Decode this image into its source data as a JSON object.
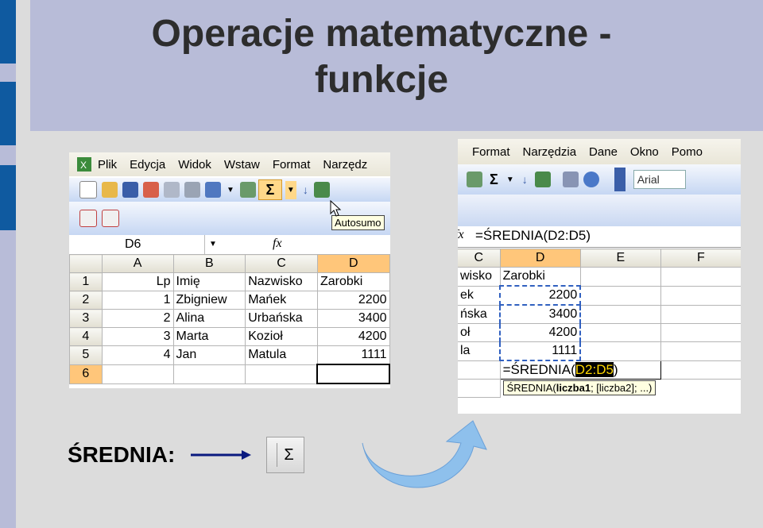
{
  "slide": {
    "title_line1": "Operacje matematyczne -",
    "title_line2": "funkcje",
    "caption": "ŚREDNIA:",
    "sigma": "Σ"
  },
  "left_excel": {
    "menu": [
      "Plik",
      "Edycja",
      "Widok",
      "Wstaw",
      "Format",
      "Narzędz"
    ],
    "tooltip": "Autosumo",
    "name_box": "D6",
    "fx": "fx",
    "columns": [
      "A",
      "B",
      "C",
      "D"
    ],
    "rows": [
      {
        "n": "1",
        "a": "Lp",
        "b": "Imię",
        "c": "Nazwisko",
        "d": "Zarobki"
      },
      {
        "n": "2",
        "a": "1",
        "b": "Zbigniew",
        "c": "Mańek",
        "d": "2200"
      },
      {
        "n": "3",
        "a": "2",
        "b": "Alina",
        "c": "Urbańska",
        "d": "3400"
      },
      {
        "n": "4",
        "a": "3",
        "b": "Marta",
        "c": "Kozioł",
        "d": "4200"
      },
      {
        "n": "5",
        "a": "4",
        "b": "Jan",
        "c": "Matula",
        "d": "1111"
      },
      {
        "n": "6",
        "a": "",
        "b": "",
        "c": "",
        "d": ""
      }
    ]
  },
  "right_excel": {
    "menu": [
      "Format",
      "Narzędzia",
      "Dane",
      "Okno",
      "Pomo"
    ],
    "font_box": "Arial",
    "formula": "=ŚREDNIA(D2:D5)",
    "columns": [
      "C",
      "D",
      "E",
      "F"
    ],
    "rows": [
      {
        "c": "wisko",
        "d": "Zarobki"
      },
      {
        "c": "ek",
        "d": "2200"
      },
      {
        "c": "ńska",
        "d": "3400"
      },
      {
        "c": "oł",
        "d": "4200"
      },
      {
        "c": "la",
        "d": "1111"
      }
    ],
    "edit_prefix": "=ŚREDNIA(",
    "edit_range": "D2:D5",
    "edit_suffix": ")",
    "hint_func": "ŚREDNIA(",
    "hint_arg1": "liczba1",
    "hint_rest": "; [liczba2]; ...)"
  },
  "colors": {
    "accent_blue": "#0f5aa0",
    "header_bg": "#b8bcd8",
    "content_bg": "#dcdcdc",
    "selected_col": "#ffc67a",
    "arrow_fill": "#8ec0ec"
  }
}
